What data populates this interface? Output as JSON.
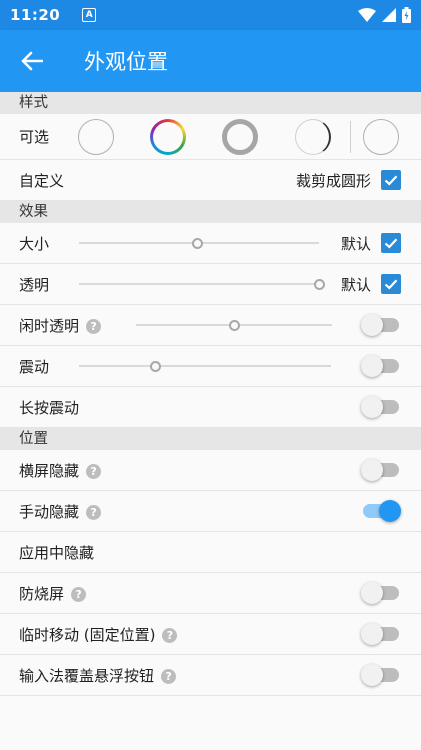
{
  "status_bar": {
    "time": "11:20",
    "badge": "A"
  },
  "app_bar": {
    "title": "外观位置",
    "back_icon": "arrow-left-icon"
  },
  "colors": {
    "primary": "#2196f3",
    "status": "#1e88e5",
    "accent": "#2a8ad6"
  },
  "sections": {
    "style": "样式",
    "effect": "效果",
    "position": "位置"
  },
  "style": {
    "options_label": "可选",
    "custom_label": "自定义",
    "crop_circle_label": "裁剪成圆形",
    "crop_circle_checked": true
  },
  "effect": {
    "size": {
      "label": "大小",
      "default_label": "默认",
      "value": 0.49,
      "checked": true
    },
    "opacity": {
      "label": "透明",
      "default_label": "默认",
      "value": 1.0,
      "checked": true
    },
    "idle_opacity": {
      "label": "闲时透明",
      "value": 0.5,
      "enabled": false
    },
    "vibrate": {
      "label": "震动",
      "value": 0.3,
      "enabled": false
    },
    "long_press_vibrate": {
      "label": "长按震动",
      "enabled": false
    }
  },
  "position": {
    "landscape_hide": {
      "label": "横屏隐藏",
      "enabled": false
    },
    "manual_hide": {
      "label": "手动隐藏",
      "enabled": true
    },
    "hide_in_app": {
      "label": "应用中隐藏"
    },
    "burn_in": {
      "label": "防烧屏",
      "enabled": false
    },
    "temp_move": {
      "label": "临时移动 (固定位置)",
      "enabled": false
    },
    "ime_cover": {
      "label": "输入法覆盖悬浮按钮",
      "enabled": false
    }
  }
}
